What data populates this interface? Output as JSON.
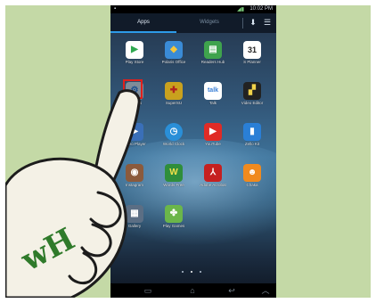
{
  "status_bar": {
    "left_icon": "notification-icon",
    "time": "10:02 PM"
  },
  "tabs": {
    "apps": "Apps",
    "widgets": "Widgets"
  },
  "apps": [
    {
      "label": "Play Store",
      "icon": "play-store-icon",
      "color": "#ffffff"
    },
    {
      "label": "Polaris Office",
      "icon": "polaris-office-icon",
      "color": "#3a8bd6"
    },
    {
      "label": "Readers Hub",
      "icon": "readers-hub-icon",
      "color": "#3fa34d"
    },
    {
      "label": "S Planner",
      "icon": "s-planner-icon",
      "color": "#ffffff"
    },
    {
      "label": "Settings",
      "icon": "settings-icon",
      "color": "#7f8c99"
    },
    {
      "label": "SuperSU",
      "icon": "supersu-icon",
      "color": "#c9a11e"
    },
    {
      "label": "Talk",
      "icon": "talk-icon",
      "color": "#ffffff"
    },
    {
      "label": "Video Editor",
      "icon": "video-editor-icon",
      "color": "#222222"
    },
    {
      "label": "Video Player",
      "icon": "video-player-icon",
      "color": "#3a6fb8"
    },
    {
      "label": "World Clock",
      "icon": "world-clock-icon",
      "color": "#2a8fd8"
    },
    {
      "label": "YouTube",
      "icon": "youtube-icon",
      "color": "#e02b26"
    },
    {
      "label": "Zello Kit",
      "icon": "zello-kit-icon",
      "color": "#2a7fd6"
    },
    {
      "label": "Instagram",
      "icon": "instagram-icon",
      "color": "#8b5a3c"
    },
    {
      "label": "Words Free",
      "icon": "words-free-icon",
      "color": "#2f8e3b"
    },
    {
      "label": "Adobe Acrobat",
      "icon": "adobe-acrobat-icon",
      "color": "#c62020"
    },
    {
      "label": "Chaka",
      "icon": "chaka-icon",
      "color": "#f08a1e"
    },
    {
      "label": "Gallery",
      "icon": "gallery-icon",
      "color": "#5b6e84"
    },
    {
      "label": "Play Games",
      "icon": "play-games-icon",
      "color": "#6bb64a"
    }
  ],
  "watermark": {
    "text": "wH"
  },
  "colors": {
    "background": "#c4d9a6",
    "highlight": "#e0201c",
    "tab_accent": "#2d9be8"
  }
}
